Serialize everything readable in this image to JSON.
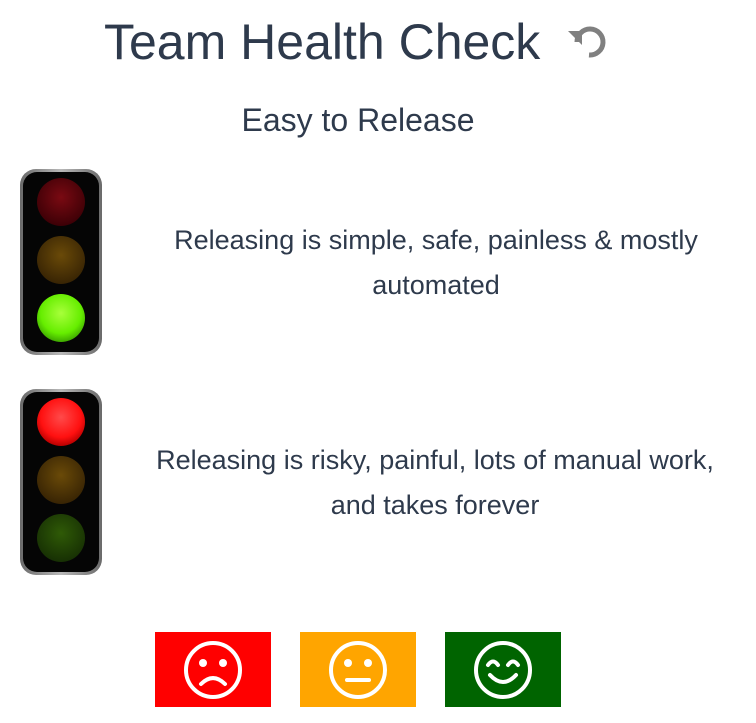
{
  "header": {
    "title": "Team Health Check",
    "reset_icon": "undo-icon"
  },
  "card": {
    "topic": "Easy to Release",
    "good": {
      "light": "green",
      "description": "Releasing is simple, safe, painless & mostly automated"
    },
    "bad": {
      "light": "red",
      "description": "Releasing is risky, painful, lots of manual work, and takes forever"
    }
  },
  "votes": [
    {
      "name": "red",
      "icon": "sad-face-icon",
      "color": "#ff0000"
    },
    {
      "name": "amber",
      "icon": "neutral-face-icon",
      "color": "#ffa500"
    },
    {
      "name": "green",
      "icon": "happy-face-icon",
      "color": "#006400"
    }
  ],
  "colors": {
    "text": "#2e3a4c",
    "icon_gray": "#808080"
  }
}
